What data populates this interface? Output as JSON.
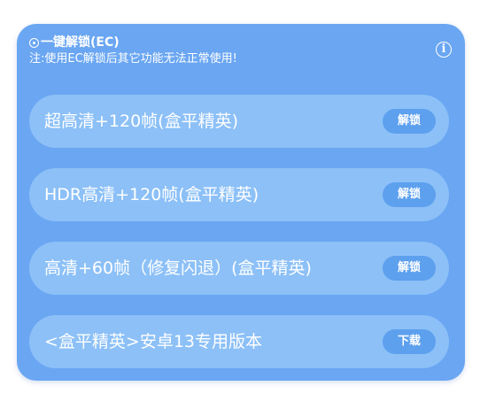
{
  "panel": {
    "title": "一键解锁(EC)",
    "note": "注:使用EC解锁后其它功能无法正常使用!",
    "info_icon": "info-icon"
  },
  "options": [
    {
      "label": "超高清+120帧(盒平精英)",
      "button": "解锁"
    },
    {
      "label": "HDR高清+120帧(盒平精英)",
      "button": "解锁"
    },
    {
      "label": "高清+60帧（修复闪退）(盒平精英)",
      "button": "解锁"
    },
    {
      "label": "<盒平精英>安卓13专用版本",
      "button": "下载"
    }
  ],
  "colors": {
    "card": "#6aa6f2",
    "row": "#8cc0f7",
    "button": "#5da0ee",
    "text": "#ffffff"
  }
}
